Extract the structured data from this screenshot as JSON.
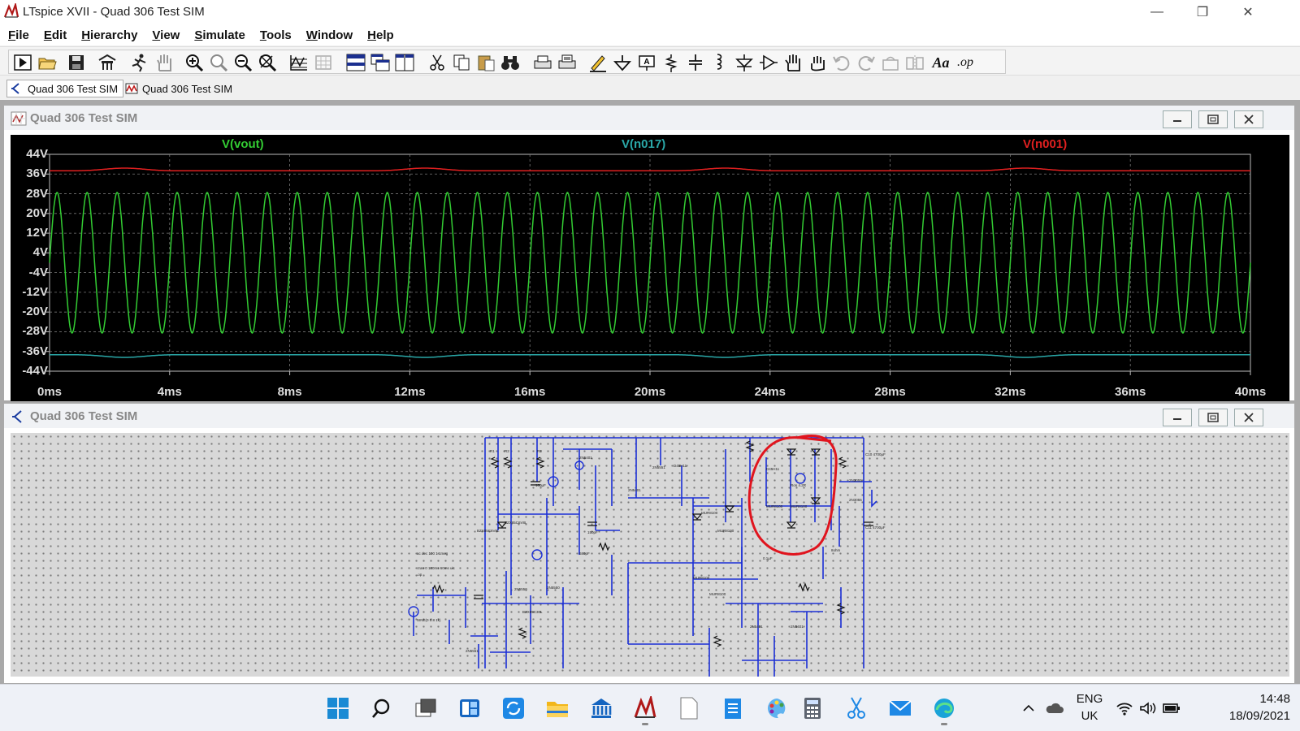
{
  "window": {
    "title": "LTspice XVII - Quad 306 Test SIM",
    "minimize": "—",
    "restore": "❐",
    "close": "✕"
  },
  "menu": [
    {
      "label": "File",
      "u": "F",
      "rest": "ile"
    },
    {
      "label": "Edit",
      "u": "E",
      "rest": "dit"
    },
    {
      "label": "Hierarchy",
      "u": "H",
      "rest": "ierarchy"
    },
    {
      "label": "View",
      "u": "V",
      "rest": "iew"
    },
    {
      "label": "Simulate",
      "u": "S",
      "rest": "imulate"
    },
    {
      "label": "Tools",
      "u": "T",
      "rest": "ools"
    },
    {
      "label": "Window",
      "u": "W",
      "rest": "indow"
    },
    {
      "label": "Help",
      "u": "H",
      "rest": "elp"
    }
  ],
  "toolbar": {
    "font_button_label": "Aa",
    "op_button_label": ".op"
  },
  "tabs": [
    {
      "label": "Quad 306 Test SIM",
      "icon": "schematic-icon",
      "active": true
    },
    {
      "label": "Quad 306 Test SIM",
      "icon": "waveform-icon",
      "active": false
    }
  ],
  "plot_window": {
    "title": "Quad 306 Test SIM"
  },
  "schematic_window": {
    "title": "Quad 306 Test SIM"
  },
  "colors": {
    "vout": "#33cc33",
    "n017": "#2aa7a7",
    "n001": "#e02020",
    "annotation": "#e0141e"
  },
  "chart_data": {
    "type": "line",
    "title": "",
    "xlabel": "",
    "ylabel": "",
    "x_ticks": [
      "0ms",
      "4ms",
      "8ms",
      "12ms",
      "16ms",
      "20ms",
      "24ms",
      "28ms",
      "32ms",
      "36ms",
      "40ms"
    ],
    "y_ticks": [
      "44V",
      "36V",
      "28V",
      "20V",
      "12V",
      "4V",
      "-4V",
      "-12V",
      "-20V",
      "-28V",
      "-36V",
      "-44V"
    ],
    "xlim": [
      0,
      40
    ],
    "ylim": [
      -44,
      44
    ],
    "grid": true,
    "legend_placement": "top",
    "series": [
      {
        "name": "V(vout)",
        "kind": "sine",
        "amplitude": 28.5,
        "frequency_hz": 1000,
        "offset": 0
      },
      {
        "name": "V(n017)",
        "kind": "rail",
        "level": -37.5,
        "ripple": 0.6,
        "ripple_period_ms": 10
      },
      {
        "name": "V(n001)",
        "kind": "rail",
        "level": 37.5,
        "ripple": 0.6,
        "ripple_period_ms": 10
      }
    ]
  },
  "taskbar": {
    "lang_line1": "ENG",
    "lang_line2": "UK",
    "time": "14:48",
    "date": "18/09/2021"
  }
}
